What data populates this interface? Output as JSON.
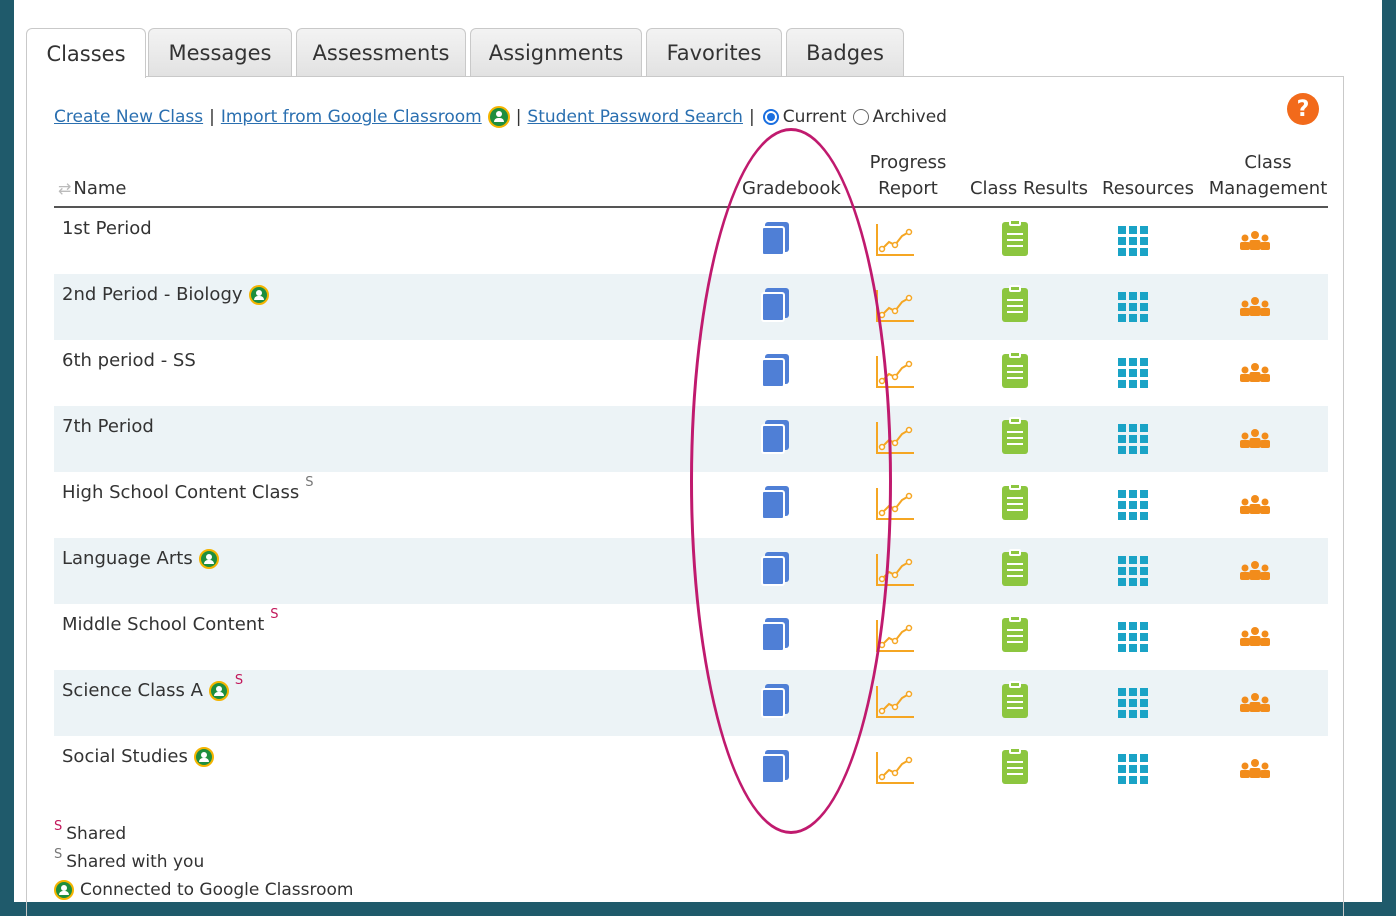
{
  "tabs": [
    {
      "label": "Classes",
      "active": true
    },
    {
      "label": "Messages",
      "active": false
    },
    {
      "label": "Assessments",
      "active": false
    },
    {
      "label": "Assignments",
      "active": false
    },
    {
      "label": "Favorites",
      "active": false
    },
    {
      "label": "Badges",
      "active": false
    }
  ],
  "toolbar": {
    "create_new_class": "Create New Class",
    "import_google": "Import from Google Classroom",
    "student_password_search": "Student Password Search",
    "separator": "|",
    "filter_current": "Current",
    "filter_archived": "Archived",
    "filter_selected": "Current",
    "help_label": "?"
  },
  "table": {
    "columns": {
      "name": "Name",
      "gradebook": "Gradebook",
      "progress_report_line1": "Progress",
      "progress_report_line2": "Report",
      "class_results": "Class Results",
      "resources": "Resources",
      "class_management_line1": "Class",
      "class_management_line2": "Management"
    },
    "rows": [
      {
        "name": "1st Period",
        "google": false,
        "shared_mark": ""
      },
      {
        "name": "2nd Period - Biology",
        "google": true,
        "shared_mark": ""
      },
      {
        "name": "6th period - SS",
        "google": false,
        "shared_mark": ""
      },
      {
        "name": "7th Period",
        "google": false,
        "shared_mark": ""
      },
      {
        "name": "High School Content Class",
        "google": false,
        "shared_mark": "S",
        "shared_type": "shared-with-you"
      },
      {
        "name": "Language Arts",
        "google": true,
        "shared_mark": ""
      },
      {
        "name": "Middle School Content",
        "google": false,
        "shared_mark": "S",
        "shared_type": "shared"
      },
      {
        "name": "Science Class A",
        "google": true,
        "shared_mark": "S",
        "shared_type": "shared"
      },
      {
        "name": "Social Studies",
        "google": true,
        "shared_mark": ""
      }
    ]
  },
  "legend": {
    "mark": "S",
    "shared": "Shared",
    "shared_with_you": "Shared with you",
    "google": "Connected to Google Classroom"
  },
  "colors": {
    "accent_link": "#2a6fb0",
    "gradebook": "#4f7fd6",
    "progress": "#f5a623",
    "class_results": "#8cc63f",
    "resources": "#1aa3c6",
    "management": "#f28c1b",
    "annotation": "#c01a6e",
    "help": "#f26a1b"
  }
}
